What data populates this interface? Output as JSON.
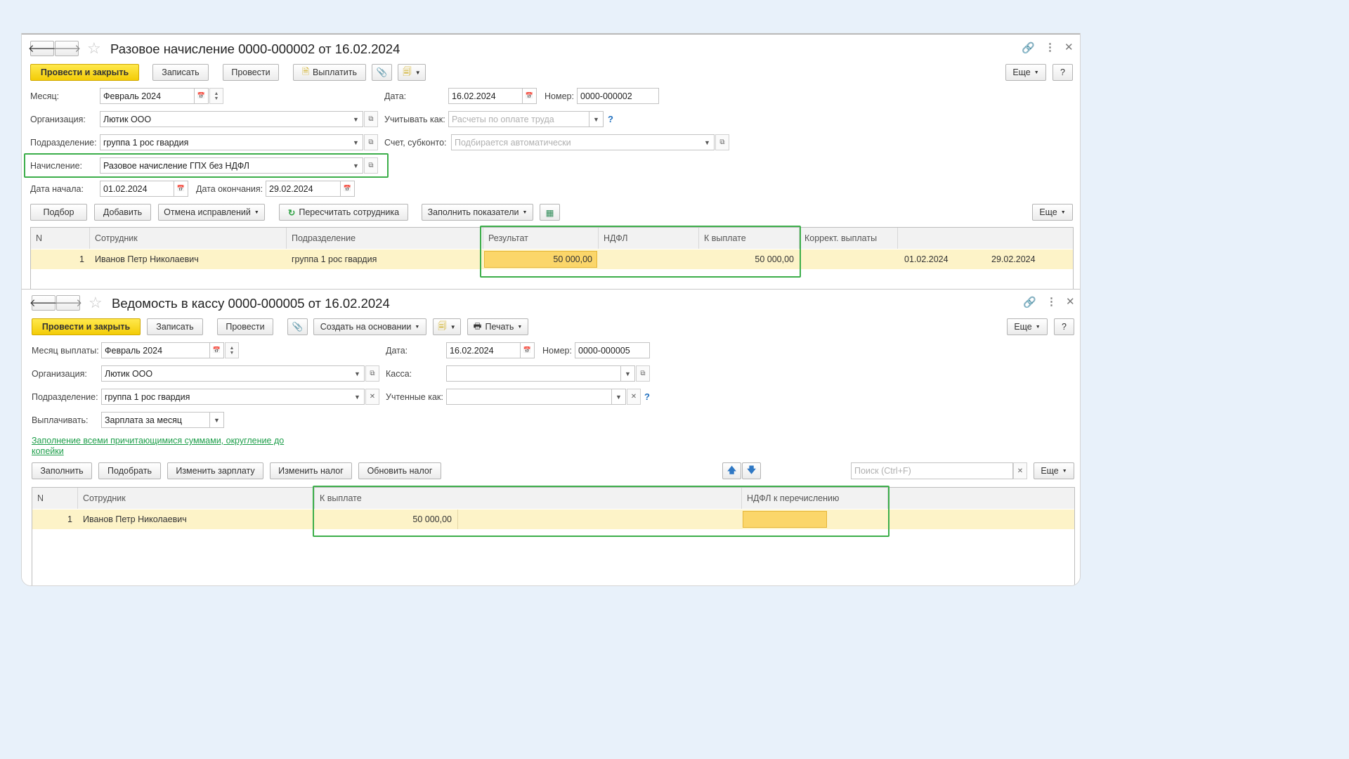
{
  "doc1": {
    "title": "Разовое начисление 0000-000002 от 16.02.2024",
    "toolbar": {
      "post_close": "Провести и закрыть",
      "save": "Записать",
      "post": "Провести",
      "pay": "Выплатить",
      "more": "Еще",
      "help": "?"
    },
    "fields": {
      "month_label": "Месяц:",
      "month_value": "Февраль 2024",
      "date_label": "Дата:",
      "date_value": "16.02.2024",
      "number_label": "Номер:",
      "number_value": "0000-000002",
      "org_label": "Организация:",
      "org_value": "Лютик ООО",
      "account_as_label": "Учитывать как:",
      "account_as_placeholder": "Расчеты по оплате труда",
      "dept_label": "Подразделение:",
      "dept_value": "группа 1 рос гвардия",
      "account_label": "Счет, субконто:",
      "account_placeholder": "Подбирается автоматически",
      "accrual_label": "Начисление:",
      "accrual_value": "Разовое начисление ГПХ без НДФЛ",
      "start_label": "Дата начала:",
      "start_value": "01.02.2024",
      "end_label": "Дата окончания:",
      "end_value": "29.02.2024"
    },
    "table_toolbar": {
      "select": "Подбор",
      "add": "Добавить",
      "cancel_fix": "Отмена исправлений",
      "recalc": "Пересчитать сотрудника",
      "fill": "Заполнить показатели",
      "more": "Еще"
    },
    "columns": [
      "N",
      "Сотрудник",
      "Подразделение",
      "Результат",
      "НДФЛ",
      "К выплате",
      "Коррект. выплаты"
    ],
    "rows": [
      {
        "n": "1",
        "employee": "Иванов Петр Николаевич",
        "dept": "группа 1 рос гвардия",
        "result": "50 000,00",
        "ndfl": "",
        "to_pay": "50 000,00",
        "correction": "",
        "date_from": "01.02.2024",
        "date_to": "29.02.2024"
      }
    ]
  },
  "doc2": {
    "title": "Ведомость в кассу 0000-000005 от 16.02.2024",
    "toolbar": {
      "post_close": "Провести и закрыть",
      "save": "Записать",
      "post": "Провести",
      "create_based": "Создать на основании",
      "print": "Печать",
      "more": "Еще",
      "help": "?"
    },
    "fields": {
      "month_label": "Месяц выплаты:",
      "month_value": "Февраль 2024",
      "date_label": "Дата:",
      "date_value": "16.02.2024",
      "number_label": "Номер:",
      "number_value": "0000-000005",
      "org_label": "Организация:",
      "org_value": "Лютик ООО",
      "cash_label": "Касса:",
      "cash_value": "",
      "dept_label": "Подразделение:",
      "dept_value": "группа 1 рос гвардия",
      "counted_label": "Учтенные как:",
      "counted_value": "",
      "pay_label": "Выплачивать:",
      "pay_value": "Зарплата за месяц"
    },
    "fill_link": [
      "Заполнение всеми причитающимися суммами, округление до",
      "копейки"
    ],
    "table_toolbar": {
      "fill": "Заполнить",
      "pick": "Подобрать",
      "change_salary": "Изменить зарплату",
      "change_tax": "Изменить налог",
      "update_tax": "Обновить налог",
      "search_placeholder": "Поиск (Ctrl+F)",
      "more": "Еще"
    },
    "columns": [
      "N",
      "Сотрудник",
      "К выплате",
      "НДФЛ к перечислению"
    ],
    "rows": [
      {
        "n": "1",
        "employee": "Иванов Петр Николаевич",
        "to_pay": "50 000,00",
        "ndfl_transfer": ""
      }
    ]
  },
  "colors": {
    "accent_yellow": "#f5d40f",
    "highlight_green": "#3cae4a",
    "row_highlight": "#fdf3c8",
    "link_green": "#1d9e4a"
  }
}
